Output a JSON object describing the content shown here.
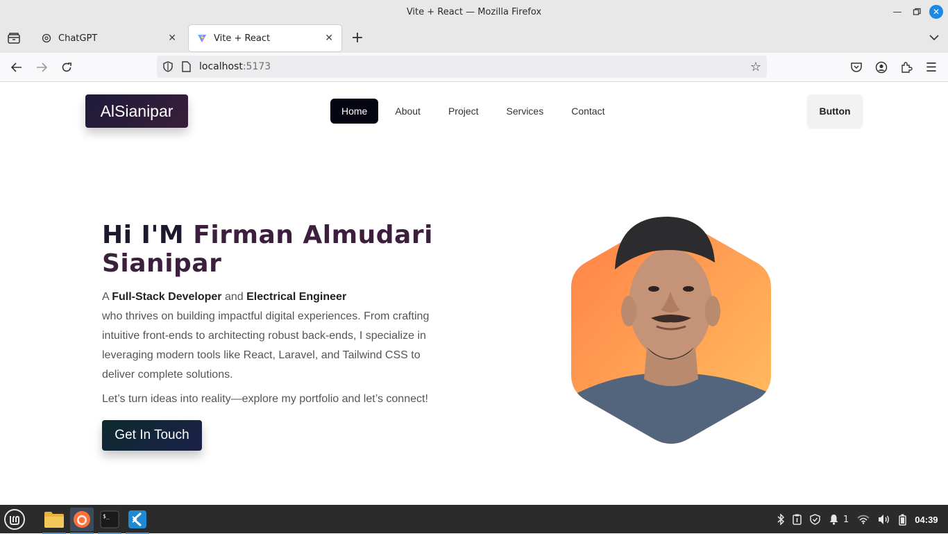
{
  "browser": {
    "window_title": "Vite + React — Mozilla Firefox",
    "tabs": [
      {
        "label": "ChatGPT",
        "active": false
      },
      {
        "label": "Vite + React",
        "active": true
      }
    ],
    "url_host": "localhost",
    "url_port": ":5173"
  },
  "site": {
    "logo_text": "AlSianipar",
    "nav_items": [
      "Home",
      "About",
      "Project",
      "Services",
      "Contact"
    ],
    "active_nav": "Home",
    "nav_button": "Button"
  },
  "hero": {
    "greeting": "Hi I'M ",
    "name": "Firman Almudari Sianipar",
    "intro_prefix": "A ",
    "role1": "Full-Stack Developer",
    "intro_and": " and ",
    "role2": "Electrical Engineer",
    "intro_rest": "who thrives on building impactful digital experiences. From crafting intuitive front-ends to architecting robust back-ends, I specialize in leveraging modern tools like React, Laravel, and Tailwind CSS to deliver complete solutions.",
    "cta_text": "Let’s turn ideas into reality—explore my portfolio and let’s connect!",
    "cta_button": "Get In Touch"
  },
  "taskbar": {
    "notification_count": "1",
    "clock": "04:39"
  },
  "colors": {
    "accent_dark": "#050511",
    "name_color": "#3b1f3d",
    "hex_gradient_top": "#ff8a4c",
    "hex_gradient_bottom": "#ffbf5e"
  }
}
